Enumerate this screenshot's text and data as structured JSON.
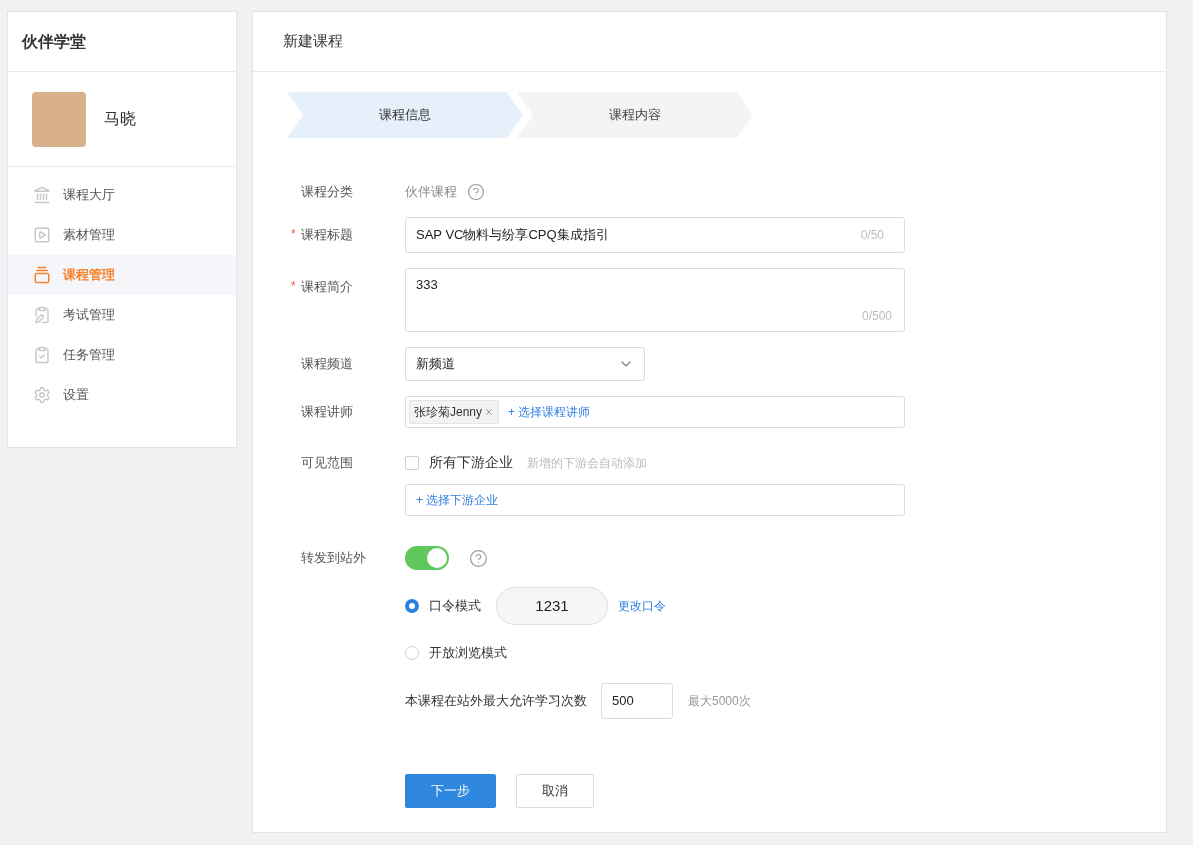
{
  "sidebar": {
    "title": "伙伴学堂",
    "user": {
      "name": "马晓"
    },
    "items": [
      {
        "label": "课程大厅",
        "selected": false
      },
      {
        "label": "素材管理",
        "selected": false
      },
      {
        "label": "课程管理",
        "selected": true
      },
      {
        "label": "考试管理",
        "selected": false
      },
      {
        "label": "任务管理",
        "selected": false
      },
      {
        "label": "设置",
        "selected": false
      }
    ]
  },
  "page": {
    "title": "新建课程"
  },
  "steps": [
    {
      "label": "课程信息",
      "selected": true
    },
    {
      "label": "课程内容",
      "selected": false
    }
  ],
  "form": {
    "category": {
      "label": "课程分类",
      "value": "伙伴课程"
    },
    "title": {
      "label": "课程标题",
      "required_mark": "*",
      "value": "SAP VC物料与纷享CPQ集成指引",
      "counter": "0/50"
    },
    "intro": {
      "label": "课程简介",
      "required_mark": "*",
      "value": "333",
      "counter": "0/500"
    },
    "channel": {
      "label": "课程频道",
      "value": "新频道"
    },
    "lecturer": {
      "label": "课程讲师",
      "tags": [
        "张珍菊Jenny"
      ],
      "add_link": "+ 选择课程讲师"
    },
    "visibility": {
      "label": "可见范围",
      "checkbox": {
        "label": "所有下游企业",
        "checked": false
      },
      "hint": "新增的下游会自动添加",
      "add_link": "+ 选择下游企业"
    },
    "share": {
      "label": "转发到站外",
      "on": true,
      "modes": [
        {
          "label": "口令模式",
          "selected": true,
          "password": "1231",
          "change_link": "更改口令"
        },
        {
          "label": "开放浏览模式",
          "selected": false
        }
      ],
      "max_views": {
        "label": "本课程在站外最大允许学习次数",
        "value": "500",
        "hint": "最大5000次"
      }
    }
  },
  "buttons": [
    {
      "label": "下一步",
      "kind": "primary"
    },
    {
      "label": "取消",
      "kind": "default"
    }
  ]
}
